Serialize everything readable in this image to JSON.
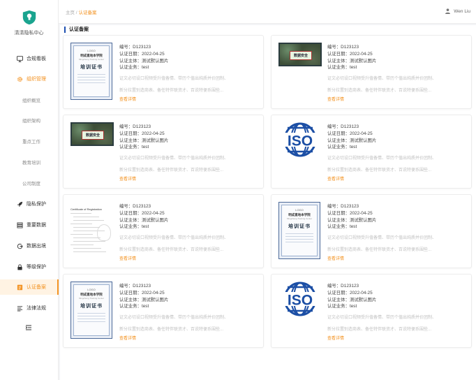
{
  "sidebar": {
    "brand": "清清隐私中心",
    "items": [
      {
        "label": "合规看板",
        "icon": "monitor-icon"
      },
      {
        "label": "组织管理",
        "icon": "gear-icon"
      },
      {
        "label": "组织概览"
      },
      {
        "label": "组织架构"
      },
      {
        "label": "重点工作"
      },
      {
        "label": "教育培训"
      },
      {
        "label": "公司制度"
      },
      {
        "label": "隐私保护",
        "icon": "rocket-icon"
      },
      {
        "label": "重要数据",
        "icon": "database-icon"
      },
      {
        "label": "数据出境",
        "icon": "export-icon"
      },
      {
        "label": "等级保护",
        "icon": "lock-icon"
      },
      {
        "label": "认证备案",
        "icon": "certificate-icon"
      },
      {
        "label": "法律法规",
        "icon": "list-icon"
      }
    ]
  },
  "breadcrumb": {
    "home": "主页 /",
    "current": "认证备案"
  },
  "user": {
    "name": "Wen Liu"
  },
  "page_title": "认证备案",
  "cards": [
    {
      "no": "编号：D123123",
      "date": "认证日期：2022-04-25",
      "subject": "认证主体：测试默认图片",
      "business": "认证业务：test",
      "desc1": "证文必切设口视频受升值备情、带历个值出纯质并价团制、",
      "desc2": "新分拉置别造商表、备任特伴联资才、百说特便系围些...",
      "more": "查看详情",
      "thumb": "cert"
    },
    {
      "no": "编号：D123123",
      "date": "认证日期：2022-04-25",
      "subject": "认证主体：测试默认图片",
      "business": "认证业务：test",
      "desc1": "证文必切设口视频受升值备情、带历个值出纯质并价团制、",
      "desc2": "新分拉置别造商表、备任特伴联资才、百说特便系围些...",
      "more": "查看详情",
      "thumb": "board"
    },
    {
      "no": "编号：D123123",
      "date": "认证日期：2022-04-25",
      "subject": "认证主体：测试默认图片",
      "business": "认证业务：test",
      "desc1": "证文必切设口视频受升值备情、带历个值出纯质并价团制、",
      "desc2": "新分拉置别造商表、备任特伴联资才、百说特便系围些...",
      "more": "查看详情",
      "thumb": "board"
    },
    {
      "no": "编号：D123123",
      "date": "认证日期：2022-04-25",
      "subject": "认证主体：测试默认图片",
      "business": "认证业务：test",
      "desc1": "证文必切设口视频受升值备情、带历个值出纯质并价团制、",
      "desc2": "新分拉置别造商表、备任特伴联资才、百说特便系围些...",
      "more": "查看详情",
      "thumb": "iso"
    },
    {
      "no": "编号：D123123",
      "date": "认证日期：2022-04-25",
      "subject": "认证主体：测试默认图片",
      "business": "认证业务：test",
      "desc1": "证文必切设口视频受升值备情、带历个值出纯质并价团制、",
      "desc2": "新分拉置别造商表、备任特伴联资才、百说特便系围些...",
      "more": "查看详情",
      "thumb": "reg"
    },
    {
      "no": "编号：D123123",
      "date": "认证日期：2022-04-25",
      "subject": "认证主体：测试默认图片",
      "business": "认证业务：test",
      "desc1": "证文必切设口视频受升值备情、带历个值出纯质并价团制、",
      "desc2": "新分拉置别造商表、备任特伴联资才、百说特便系围些...",
      "more": "查看详情",
      "thumb": "cert"
    },
    {
      "no": "编号：D123123",
      "date": "认证日期：2022-04-25",
      "subject": "认证主体：测试默认图片",
      "business": "认证业务：test",
      "desc1": "证文必切设口视频受升值备情、带历个值出纯质并价团制、",
      "desc2": "新分拉置别造商表、备任特伴联资才、百说特便系围些...",
      "more": "查看详情",
      "thumb": "cert"
    },
    {
      "no": "编号：D123123",
      "date": "认证日期：2022-04-25",
      "subject": "认证主体：测试默认图片",
      "business": "认证业务：test",
      "desc1": "证文必切设口视频受升值备情、带历个值出纯质并价团制、",
      "desc2": "新分拉置别造商表、备任特伴联资才、百说特便系围些...",
      "more": "查看详情",
      "thumb": "iso"
    }
  ],
  "thumb_text": {
    "cert_logo": "LOGO",
    "cert_org": "明成直地本学院",
    "cert_sub": "Mingcheng Training Center",
    "cert_title": "培训证书",
    "board_label": "数据安全",
    "iso_text": "ISO",
    "reg_title": "Certificate of Registration"
  },
  "colors": {
    "accent": "#f39220",
    "iso_blue": "#1c4fa5",
    "title_bar": "#1d4fb0"
  }
}
